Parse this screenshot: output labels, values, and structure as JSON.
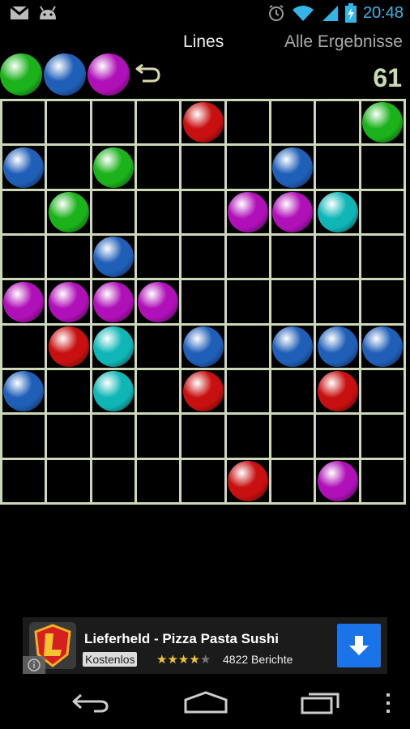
{
  "status_bar": {
    "time": "20:48",
    "left_icons": [
      "gmail-icon",
      "android-icon"
    ],
    "right_icons": [
      "alarm-icon",
      "wifi-icon",
      "signal-icon",
      "battery-charging-icon"
    ]
  },
  "app_bar": {
    "title": "Lines",
    "results_link": "Alle Ergebnisse"
  },
  "next_balls": [
    "green",
    "blue",
    "magenta"
  ],
  "score": "61",
  "colors": {
    "green": "#1bb21b",
    "blue": "#1f5fb8",
    "magenta": "#b010b8",
    "red": "#c81010",
    "cyan": "#10b6b6",
    "grid_line": "#cdd8b8",
    "score_color": "#c9dcb0",
    "accent": "#33b5e5"
  },
  "board": {
    "rows": 9,
    "cols": 9,
    "balls": [
      {
        "row": 0,
        "col": 4,
        "color": "red"
      },
      {
        "row": 0,
        "col": 8,
        "color": "green"
      },
      {
        "row": 1,
        "col": 0,
        "color": "blue"
      },
      {
        "row": 1,
        "col": 2,
        "color": "green"
      },
      {
        "row": 1,
        "col": 6,
        "color": "blue"
      },
      {
        "row": 2,
        "col": 1,
        "color": "green"
      },
      {
        "row": 2,
        "col": 5,
        "color": "magenta"
      },
      {
        "row": 2,
        "col": 6,
        "color": "magenta"
      },
      {
        "row": 2,
        "col": 7,
        "color": "cyan"
      },
      {
        "row": 3,
        "col": 2,
        "color": "blue"
      },
      {
        "row": 4,
        "col": 0,
        "color": "magenta"
      },
      {
        "row": 4,
        "col": 1,
        "color": "magenta"
      },
      {
        "row": 4,
        "col": 2,
        "color": "magenta"
      },
      {
        "row": 4,
        "col": 3,
        "color": "magenta"
      },
      {
        "row": 5,
        "col": 1,
        "color": "red"
      },
      {
        "row": 5,
        "col": 2,
        "color": "cyan"
      },
      {
        "row": 5,
        "col": 4,
        "color": "blue"
      },
      {
        "row": 5,
        "col": 6,
        "color": "blue"
      },
      {
        "row": 5,
        "col": 7,
        "color": "blue"
      },
      {
        "row": 5,
        "col": 8,
        "color": "blue"
      },
      {
        "row": 6,
        "col": 0,
        "color": "blue"
      },
      {
        "row": 6,
        "col": 2,
        "color": "cyan"
      },
      {
        "row": 6,
        "col": 4,
        "color": "red"
      },
      {
        "row": 6,
        "col": 7,
        "color": "red"
      },
      {
        "row": 8,
        "col": 5,
        "color": "red"
      },
      {
        "row": 8,
        "col": 7,
        "color": "magenta"
      }
    ]
  },
  "ad": {
    "title": "Lieferheld - Pizza Pasta Sushi",
    "price": "Kostenlos",
    "rating_stars": "★★★★★",
    "rating": 4,
    "reviews": "4822 Berichte",
    "download_icon": "download-arrow-icon",
    "info_icon": "info-icon"
  },
  "nav_bar": {
    "buttons": [
      "back-icon",
      "home-icon",
      "recent-apps-icon",
      "overflow-menu-icon"
    ]
  }
}
